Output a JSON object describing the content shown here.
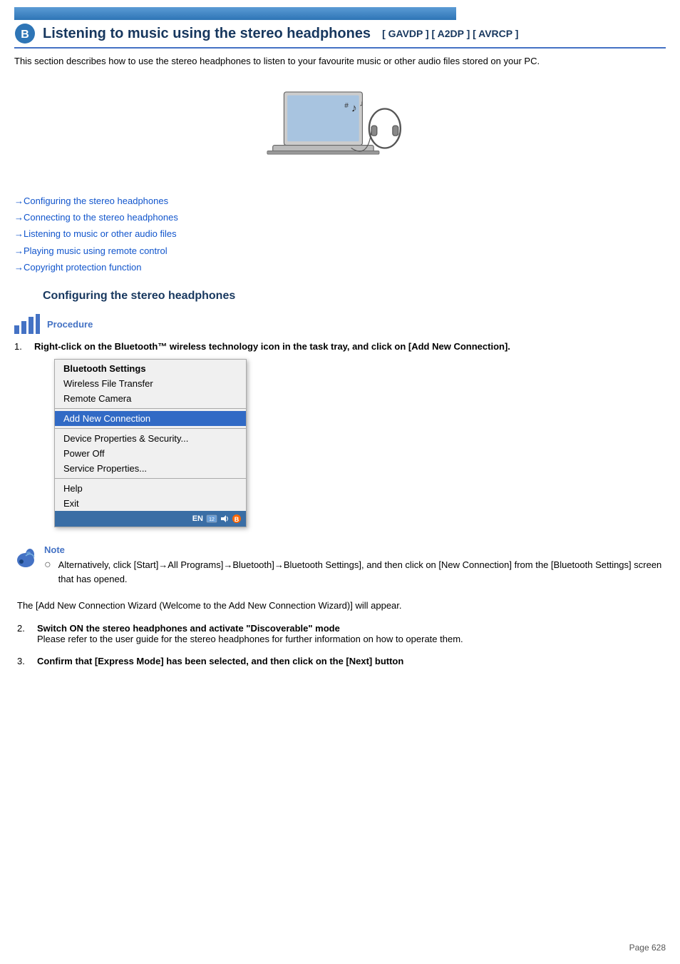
{
  "topBar": {},
  "header": {
    "title": "Listening to music using the stereo headphones",
    "tags": "[ GAVDP ]    [ A2DP ]    [ AVRCP ]"
  },
  "description": "This section describes how to use the stereo headphones to listen to your favourite music or other audio files stored on your PC.",
  "links": [
    "→Configuring the stereo headphones",
    "→Connecting to the stereo headphones",
    "→Listening to music or other audio files",
    "→Playing music using remote control",
    "→Copyright protection function"
  ],
  "sectionHeading": "Configuring the stereo headphones",
  "procedureLabel": "Procedure",
  "steps": [
    {
      "number": "1.",
      "boldText": "Right-click on the Bluetooth™ wireless technology icon in the task tray, and click on [Add New Connection].",
      "normalText": ""
    },
    {
      "number": "2.",
      "boldText": "Switch ON the stereo headphones and activate \"Discoverable\" mode",
      "normalText": "Please refer to the user guide for the stereo headphones for further information on how to operate them."
    },
    {
      "number": "3.",
      "boldText": "Confirm that [Express Mode] has been selected, and then click on the [Next] button",
      "normalText": ""
    }
  ],
  "contextMenu": {
    "items": [
      {
        "label": "Bluetooth Settings",
        "type": "bold"
      },
      {
        "label": "Wireless File Transfer",
        "type": "normal"
      },
      {
        "label": "Remote Camera",
        "type": "normal"
      },
      {
        "label": "separator"
      },
      {
        "label": "Add New Connection",
        "type": "highlighted"
      },
      {
        "label": "separator"
      },
      {
        "label": "Device Properties & Security...",
        "type": "normal"
      },
      {
        "label": "Power Off",
        "type": "normal"
      },
      {
        "label": "Service Properties...",
        "type": "normal"
      },
      {
        "label": "separator"
      },
      {
        "label": "Help",
        "type": "normal"
      },
      {
        "label": "Exit",
        "type": "normal"
      }
    ],
    "taskbarText": "EN"
  },
  "note": {
    "label": "Note",
    "items": [
      "Alternatively, click [Start]→All Programs]→Bluetooth]→Bluetooth Settings], and then click on [New Connection] from the [Bluetooth Settings] screen that has opened."
    ]
  },
  "wizardText": "The [Add New Connection Wizard (Welcome to the Add New Connection Wizard)] will appear.",
  "pageNumber": "Page 628"
}
